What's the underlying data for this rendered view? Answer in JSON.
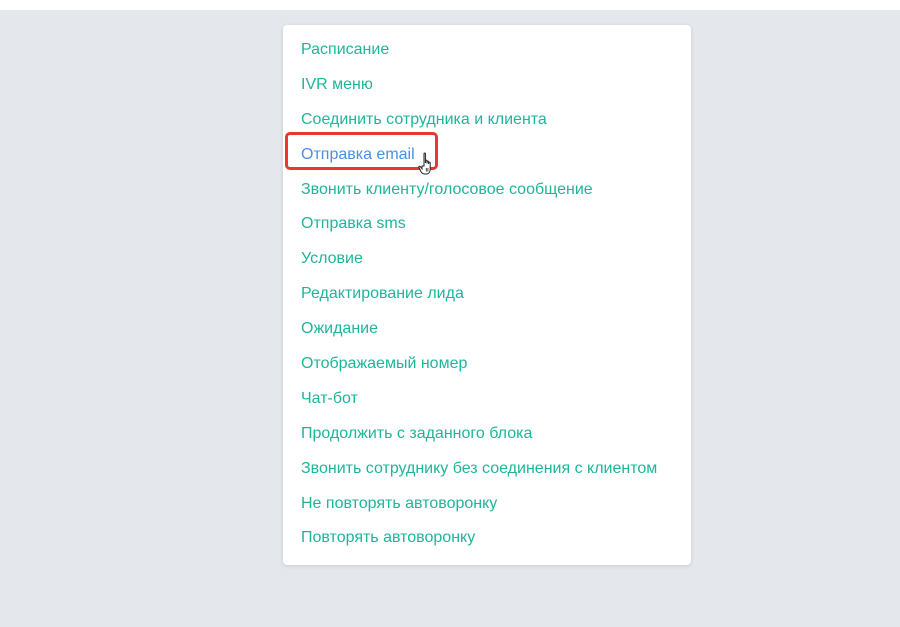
{
  "menu": {
    "items": [
      {
        "label": "Расписание"
      },
      {
        "label": "IVR меню"
      },
      {
        "label": "Соединить сотрудника и клиента"
      },
      {
        "label": "Отправка email",
        "state": "hovered"
      },
      {
        "label": "Звонить клиенту/голосовое сообщение"
      },
      {
        "label": "Отправка sms"
      },
      {
        "label": "Условие"
      },
      {
        "label": "Редактирование лида"
      },
      {
        "label": "Ожидание"
      },
      {
        "label": "Отображаемый номер"
      },
      {
        "label": "Чат-бот"
      },
      {
        "label": "Продолжить с заданного блока"
      },
      {
        "label": "Звонить сотруднику без соединения с клиентом"
      },
      {
        "label": "Не повторять автоворонку"
      },
      {
        "label": "Повторять автоворонку"
      }
    ]
  },
  "colors": {
    "item_text": "#1fb59a",
    "hovered_text": "#4a90e2",
    "highlight_border": "#e53935",
    "backdrop": "#e4e7eb"
  },
  "icons": {
    "cursor": "hand-pointer-cursor-icon"
  }
}
